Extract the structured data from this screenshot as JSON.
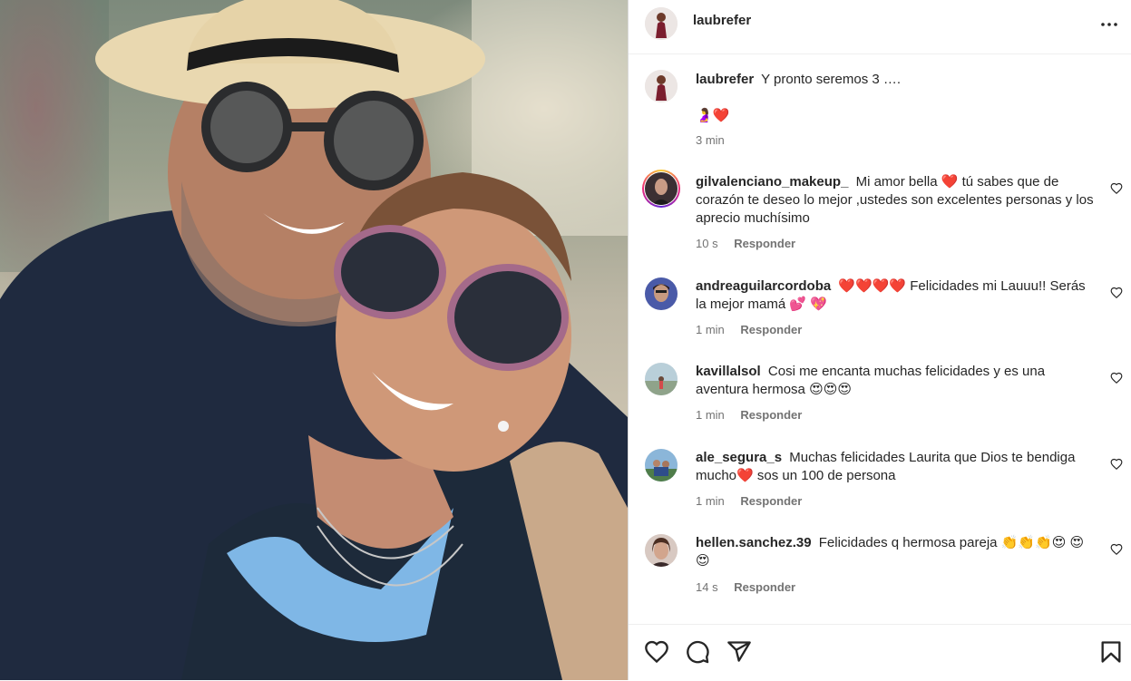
{
  "post": {
    "author": "laubrefer",
    "caption_user": "laubrefer",
    "caption_text": "Y pronto seremos 3 ….",
    "caption_emojis": "🤰❤️",
    "caption_time": "3 min"
  },
  "comments": [
    {
      "user": "gilvalenciano_makeup_",
      "text": "Mi amor bella ❤️ tú sabes que de corazón te deseo lo mejor ,ustedes son excelentes personas y los aprecio muchísimo",
      "time": "10 s",
      "reply": "Responder",
      "has_story": true
    },
    {
      "user": "andreaguilarcordoba",
      "text": "❤️❤️❤️❤️ Felicidades mi Lauuu!! Serás la mejor mamá 💕 💖",
      "time": "1 min",
      "reply": "Responder",
      "has_story": false
    },
    {
      "user": "kavillalsol",
      "text": "Cosi me encanta muchas felicidades y es una aventura hermosa 😍😍😍",
      "time": "1 min",
      "reply": "Responder",
      "has_story": false
    },
    {
      "user": "ale_segura_s",
      "text": "Muchas felicidades Laurita que Dios te bendiga mucho❤️ sos un 100 de persona",
      "time": "1 min",
      "reply": "Responder",
      "has_story": false
    },
    {
      "user": "hellen.sanchez.39",
      "text": "Felicidades q hermosa pareja 👏👏👏😍 😍😍",
      "time": "14 s",
      "reply": "Responder",
      "has_story": false
    }
  ],
  "icons": {
    "more": "more-options-icon",
    "like": "heart-icon",
    "comment": "comment-icon",
    "share": "share-icon",
    "save": "bookmark-icon"
  },
  "colors": {
    "text": "#262626",
    "secondary": "#737373",
    "border": "#dbdbdb"
  }
}
